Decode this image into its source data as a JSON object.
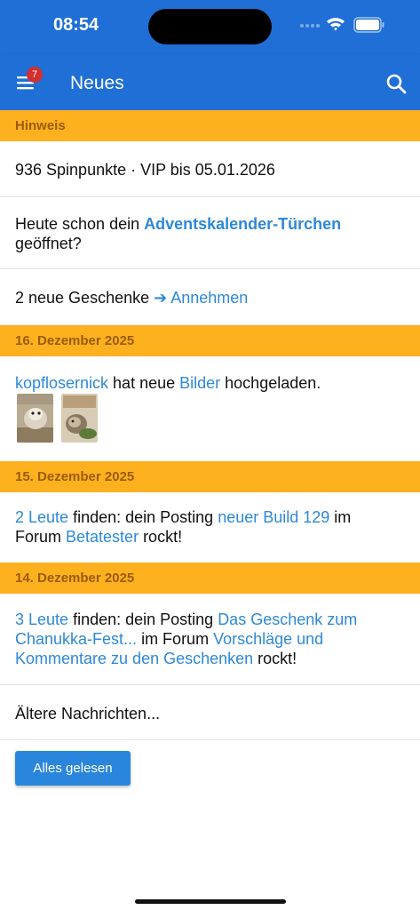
{
  "status_bar": {
    "time": "08:54"
  },
  "app_bar": {
    "title": "Neues",
    "menu_badge": "7"
  },
  "sections": {
    "hint": "Hinweis",
    "date1": "16. Dezember 2025",
    "date2": "15. Dezember 2025",
    "date3": "14. Dezember 2025"
  },
  "hint_rows": {
    "points": "936 Spinpunkte · VIP bis 05.01.2026",
    "advent_prefix": "Heute schon dein ",
    "advent_link": "Adventskalender-Türchen",
    "advent_suffix": "geöffnet?",
    "gifts_prefix": "2 neue Geschenke ",
    "gifts_link": "➔ Annehmen"
  },
  "item_images": {
    "user": "kopflosernick",
    "text1": " hat neue ",
    "link": "Bilder",
    "text2": " hochgeladen."
  },
  "item_build": {
    "people": "2 Leute",
    "text1": " finden: dein Posting ",
    "post": "neuer Build 129",
    "text2": " im",
    "text3": "Forum ",
    "forum": "Betatester",
    "text4": " rockt!"
  },
  "item_gift": {
    "people": "3 Leute",
    "text1": " finden: dein Posting ",
    "post": "Das Geschenk zum",
    "post2": "Chanukka-Fest...",
    "text2": " im Forum ",
    "forum": "Vorschläge und",
    "forum2": "Kommentare zu den Geschenken",
    "text3": " rockt!"
  },
  "older": "Ältere Nachrichten...",
  "mark_read_button": "Alles gelesen",
  "colors": {
    "primary": "#1f6fd6",
    "section": "#feb11f",
    "section_text": "#9a5c04",
    "link": "#2d88d9",
    "badge": "#d32f2f"
  },
  "icons": [
    "menu-icon",
    "search-icon",
    "wifi-icon",
    "battery-icon",
    "cellular-icon"
  ]
}
